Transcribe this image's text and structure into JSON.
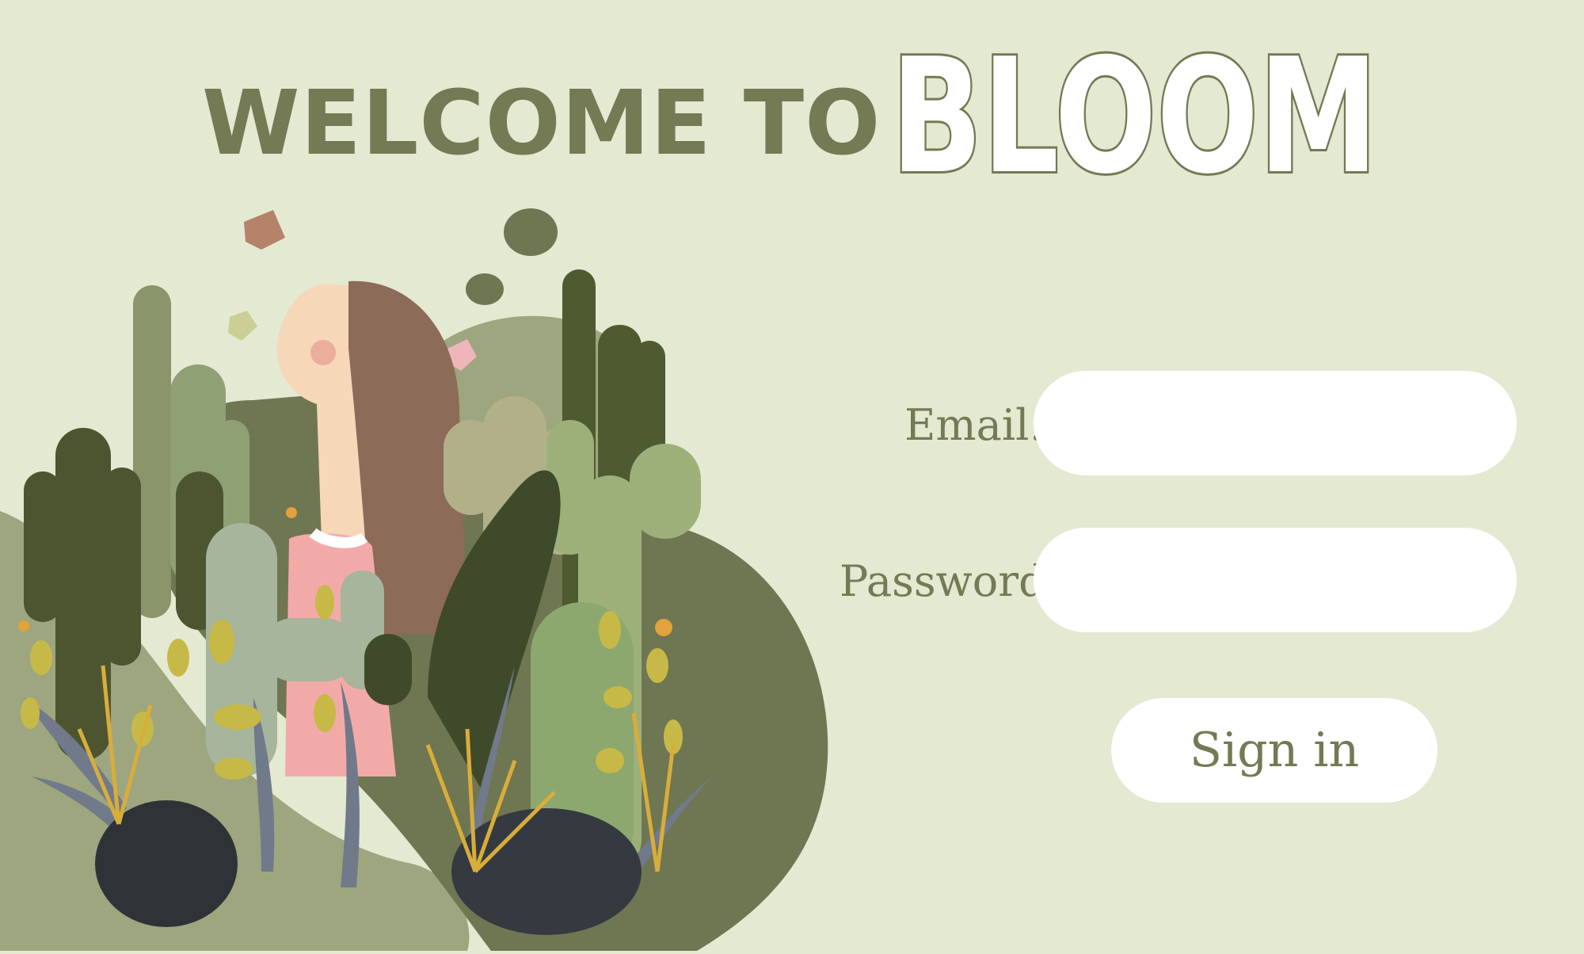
{
  "header": {
    "welcome_text": "WELCOME TO",
    "brand_name": "BLOOM"
  },
  "login_form": {
    "email_label": "Email:",
    "email_value": "",
    "password_label": "Password:",
    "password_value": "",
    "sign_in_label": "Sign in"
  },
  "illustration": {
    "subject": "girl-among-cacti",
    "icons": [
      "cactus-icon",
      "gem-icon",
      "flower-icon"
    ]
  },
  "colors": {
    "background": "#e4e9d2",
    "primary_text": "#737a54",
    "dark_blob": "#6f7652",
    "light_blob": "#9ea67f",
    "field_background": "#ffffff"
  }
}
